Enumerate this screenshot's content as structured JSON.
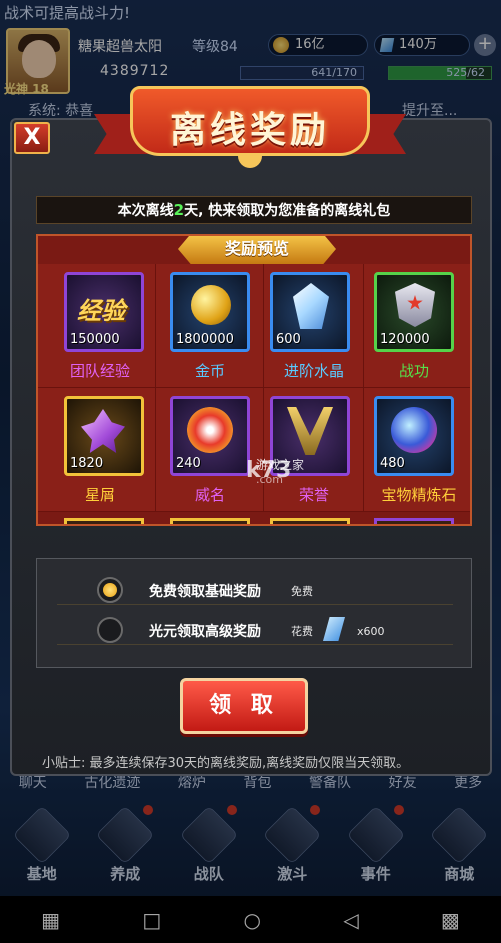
{
  "background": {
    "ticker": "战术可提高战斗力!",
    "player": {
      "name": "糖果超兽太阳",
      "level": "等级84",
      "avatar_level": "光神 18",
      "power": "4389712"
    },
    "resources": {
      "gold": "16亿",
      "gems": "140万",
      "energy": "641/170",
      "stamina": "525/62",
      "stamina_fill": 0.75
    },
    "system_msg": "系统: 恭喜",
    "system_msg_tail": "提升至...",
    "bottom_tabs": [
      "聊天",
      "古化遗迹",
      "熔炉",
      "背包",
      "警备队",
      "好友",
      "更多"
    ],
    "nav": [
      {
        "label": "基地",
        "dot": false
      },
      {
        "label": "养成",
        "dot": true
      },
      {
        "label": "战队",
        "dot": true
      },
      {
        "label": "激斗",
        "dot": true
      },
      {
        "label": "事件",
        "dot": true
      },
      {
        "label": "商城",
        "dot": false
      }
    ]
  },
  "modal": {
    "title": "离线奖励",
    "close_label": "X",
    "notice": {
      "prefix": "本次离线",
      "days": "2",
      "suffix": "天, 快来领取为您准备的离线礼包"
    },
    "preview_label": "奖励预览",
    "rewards": [
      {
        "name": "团队经验",
        "qty": "150000",
        "rarity": "purple",
        "icon": "exp-icon",
        "art": "经验"
      },
      {
        "name": "金币",
        "qty": "1800000",
        "rarity": "blue",
        "icon": "gold-coin-icon"
      },
      {
        "name": "进阶水晶",
        "qty": "600",
        "rarity": "blue",
        "icon": "crystal-icon"
      },
      {
        "name": "战功",
        "qty": "120000",
        "rarity": "green",
        "icon": "medal-icon"
      },
      {
        "name": "星屑",
        "qty": "1820",
        "rarity": "purple",
        "icon": "stardust-icon"
      },
      {
        "name": "威名",
        "qty": "240",
        "rarity": "purple",
        "icon": "fame-icon"
      },
      {
        "name": "荣誉",
        "qty": "",
        "rarity": "purple",
        "icon": "honor-icon"
      },
      {
        "name": "宝物精炼石",
        "qty": "480",
        "rarity": "gold",
        "icon": "refine-stone-icon"
      }
    ],
    "options": [
      {
        "label": "免费领取基础奖励",
        "cost_label": "免费",
        "selected": true
      },
      {
        "label": "光元领取高级奖励",
        "cost_label": "花费",
        "cost_amount": "x600",
        "selected": false
      }
    ],
    "claim_label": "领 取",
    "tip": "小贴士: 最多连续保存30天的离线奖励,离线奖励仅限当天领取。"
  },
  "watermark": {
    "logo": "k73",
    "sub": "游戏之家",
    "url": ".com"
  },
  "colors": {
    "accent_red": "#c22a18",
    "gold": "#f6c65a",
    "days_green": "#5af25a"
  }
}
